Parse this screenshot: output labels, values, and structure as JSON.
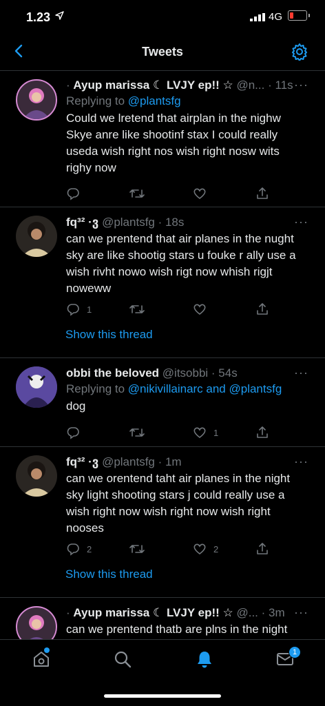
{
  "status_bar": {
    "time": "1.23",
    "network": "4G"
  },
  "header": {
    "title": "Tweets"
  },
  "tweets": [
    {
      "prefix": "· ",
      "name": "Ayup marissa ☾ LVJY ep!! ☆",
      "handle": " @n... · 11s",
      "reply_prefix": "Replying to ",
      "reply_to": "@plantsfg",
      "text": "Could we lretend that airplan in the nighw Skye anre like shootinf stax I could really useda wish right nos wish right nosw wits righy now",
      "replies": "",
      "likes": ""
    },
    {
      "prefix": "",
      "name": "fq³² ·ვ",
      "handle": " @plantsfg · 18s",
      "text": "can we prentend that air planes in the nught sky are like shootig stars u fouke r ally use a wish rivht nowo wish rigt now whish rigjt noweww",
      "replies": "1",
      "likes": "",
      "thread_link": "Show this thread"
    },
    {
      "prefix": "",
      "name": "obbi the beloved",
      "handle": " @itsobbi · 54s",
      "reply_prefix": "Replying to ",
      "reply_to": "@nikivillainarc and @plantsfg",
      "text": "dog",
      "replies": "",
      "likes": "1"
    },
    {
      "prefix": "",
      "name": "fq³² ·ვ",
      "handle": " @plantsfg · 1m",
      "text": "can we orentend taht air planes in the night sky light shooting stars j could really use a wish right now wish right now wish right nooses",
      "replies": "2",
      "likes": "2",
      "thread_link": "Show this thread"
    },
    {
      "prefix": "· ",
      "name": "Ayup marissa ☾ LVJY ep!! ☆",
      "handle": " @... · 3m",
      "text": "can we prentend thatb are plns in the night"
    }
  ],
  "more_label": "···",
  "tabbar": {
    "messages_badge": "1"
  },
  "icons": [
    "back-chevron-icon",
    "gear-icon",
    "reply-icon",
    "retweet-icon",
    "like-icon",
    "share-icon",
    "home-icon",
    "search-icon",
    "notifications-bell-icon",
    "messages-envelope-icon"
  ],
  "colors": {
    "accent": "#1d9bf0",
    "background": "#000000",
    "muted": "#71767b",
    "divider": "#2f3336"
  }
}
